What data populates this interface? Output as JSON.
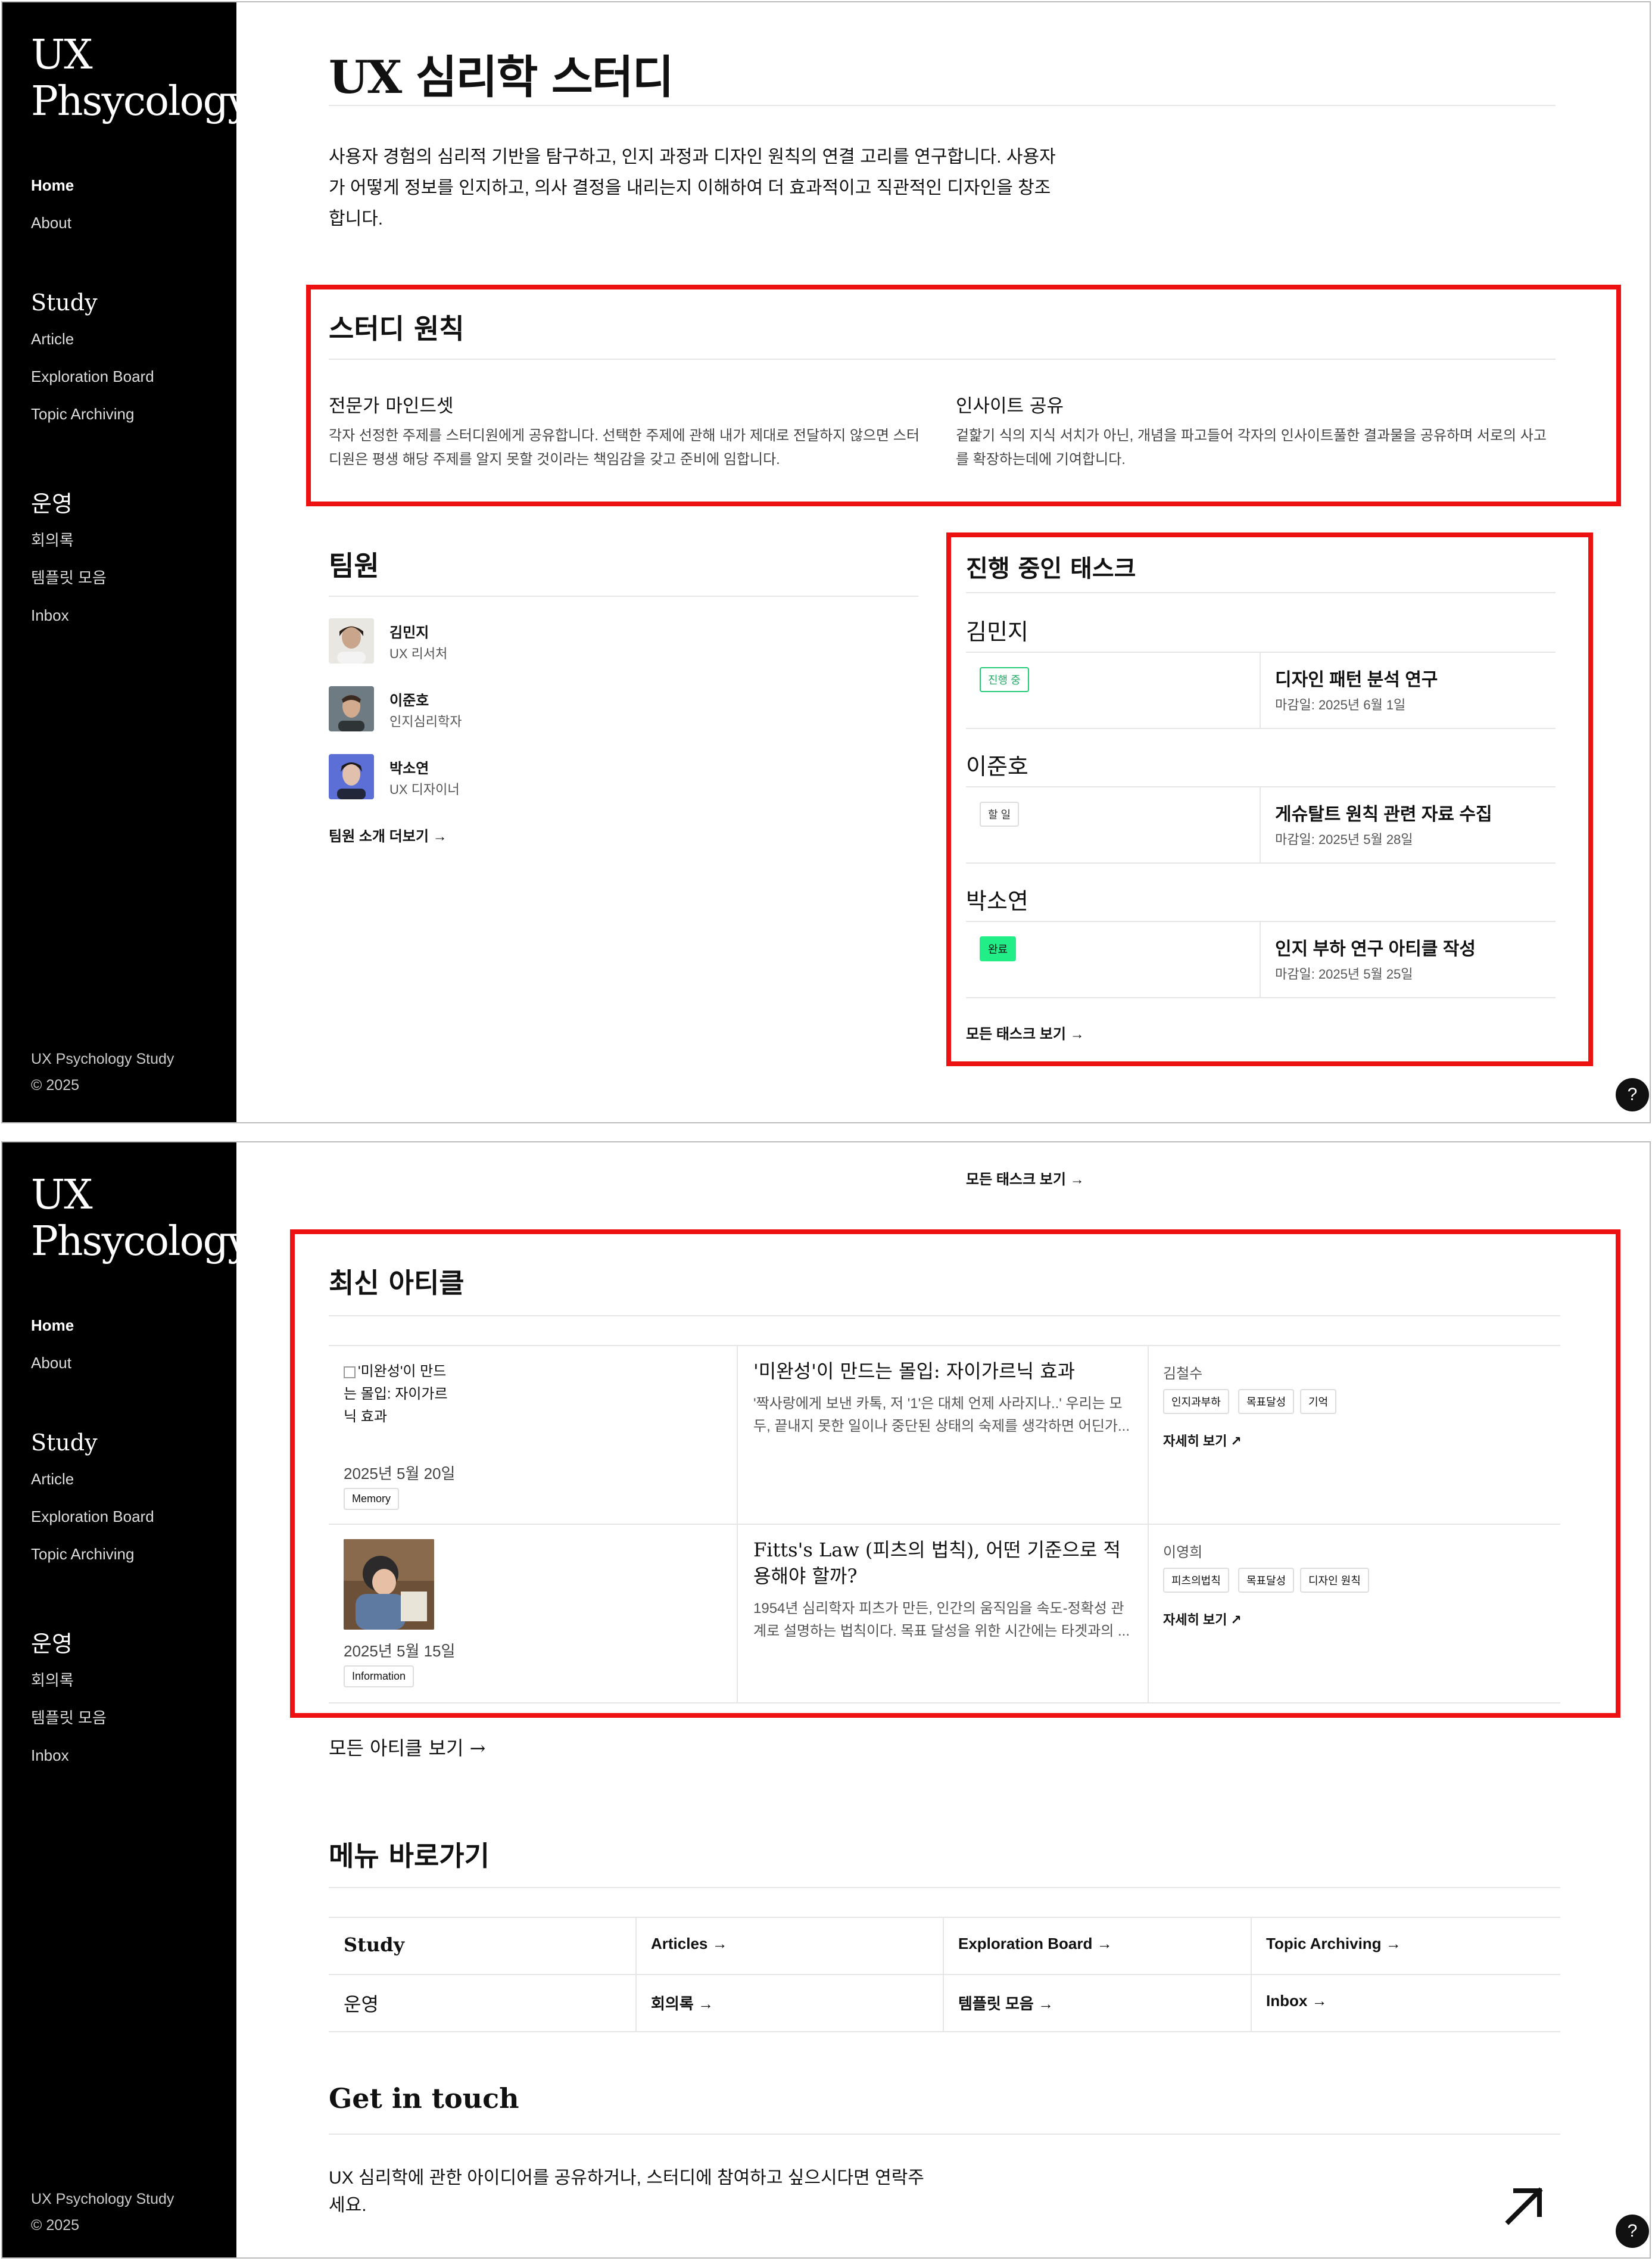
{
  "brand": {
    "line1": "UX",
    "line2": "Phsycology"
  },
  "nav": {
    "home": "Home",
    "about": "About",
    "study_heading": "Study",
    "article": "Article",
    "exploration_board": "Exploration Board",
    "topic_archiving": "Topic Archiving",
    "ops_heading": "운영",
    "minutes": "회의록",
    "templates": "템플릿 모음",
    "inbox": "Inbox"
  },
  "sidebar_footer": {
    "line1": "UX Psychology Study",
    "line2": "© 2025"
  },
  "page": {
    "title": "UX 심리학 스터디",
    "intro": "사용자 경험의 심리적 기반을 탐구하고, 인지 과정과 디자인 원칙의 연결 고리를 연구합니다. 사용자가 어떻게 정보를 인지하고, 의사 결정을 내리는지 이해하여 더 효과적이고 직관적인 디자인을 창조합니다."
  },
  "principles": {
    "title": "스터디 원칙",
    "items": [
      {
        "title": "전문가 마인드셋",
        "desc": "각자 선정한 주제를 스터디원에게 공유합니다. 선택한 주제에 관해 내가 제대로 전달하지 않으면 스터디원은 평생 해당 주제를 알지 못할 것이라는 책임감을 갖고 준비에 임합니다."
      },
      {
        "title": "인사이트 공유",
        "desc": "겉핥기 식의 지식 서치가 아닌, 개념을 파고들어 각자의 인사이트풀한 결과물을 공유하며 서로의 사고를 확장하는데에 기여합니다."
      }
    ]
  },
  "team": {
    "title": "팀원",
    "members": [
      {
        "name": "김민지",
        "role": "UX 리서처"
      },
      {
        "name": "이준호",
        "role": "인지심리학자"
      },
      {
        "name": "박소연",
        "role": "UX 디자이너"
      }
    ],
    "more": "팀원 소개 더보기 →"
  },
  "tasks": {
    "title": "진행 중인 태스크",
    "groups": [
      {
        "person": "김민지",
        "status": "진행 중",
        "task": "디자인 패턴 분석 연구",
        "due": "마감일: 2025년 6월 1일"
      },
      {
        "person": "이준호",
        "status": "할 일",
        "task": "게슈탈트 원칙 관련 자료 수집",
        "due": "마감일: 2025년 5월 28일"
      },
      {
        "person": "박소연",
        "status": "완료",
        "task": "인지 부하 연구 아티클 작성",
        "due": "마감일: 2025년 5월 25일"
      }
    ],
    "all": "모든 태스크 보기 →"
  },
  "articles": {
    "title": "최신 아티클",
    "items": [
      {
        "image_alt": "'미완성'이 만드는 몰입: 자이가르닉 효과",
        "date": "2025년 5월 20일",
        "category": "Memory",
        "title": "'미완성'이 만드는 몰입: 자이가르닉 효과",
        "desc": "'짝사랑에게 보낸 카톡, 저 '1'은 대체 언제 사라지나..' 우리는 모두, 끝내지 못한 일이나 중단된 상태의 숙제를 생각하면 어딘가...",
        "author": "김철수",
        "tags": [
          "인지과부하",
          "목표달성",
          "기억"
        ],
        "more": "자세히 보기 ↗"
      },
      {
        "image_alt": "",
        "date": "2025년 5월 15일",
        "category": "Information",
        "title": "Fitts's Law (피츠의 법칙), 어떤 기준으로 적용해야 할까?",
        "desc": "1954년 심리학자 피츠가 만든, 인간의 움직임을 속도-정확성 관계로 설명하는 법칙이다. 목표 달성을 위한 시간에는 타겟과의 ...",
        "author": "이영희",
        "tags": [
          "피츠의법칙",
          "목표달성",
          "디자인 원칙"
        ],
        "more": "자세히 보기 ↗"
      }
    ],
    "all": "모든 아티클 보기 →"
  },
  "shortcuts": {
    "title": "메뉴 바로가기",
    "rows": [
      {
        "category": "Study",
        "links": [
          "Articles →",
          "Exploration Board →",
          "Topic Archiving →"
        ]
      },
      {
        "category": "운영",
        "links": [
          "회의록 →",
          "템플릿 모음 →",
          "Inbox →"
        ]
      }
    ]
  },
  "contact": {
    "title": "Get in touch",
    "text": "UX 심리학에 관한 아이디어를 공유하거나, 스터디에 참여하고 싶으시다면 연락주세요."
  },
  "help": "?",
  "colors": {
    "sidebar": "#000000",
    "highlight": "#ee1111",
    "in_progress": "#22cc77",
    "done": "#22ee88"
  }
}
